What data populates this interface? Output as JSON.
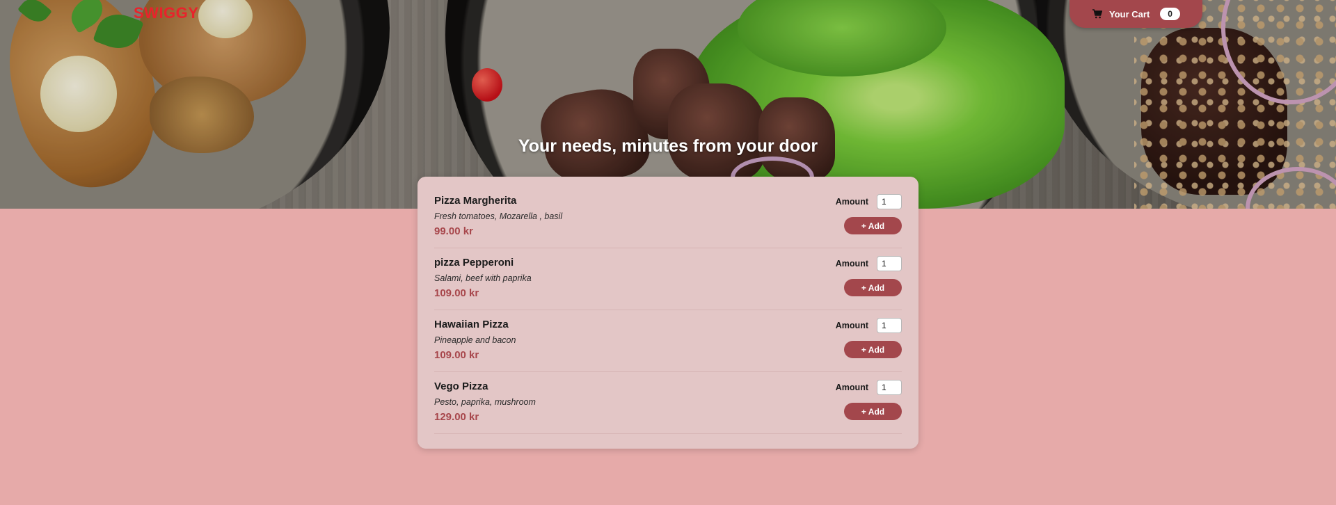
{
  "header": {
    "brand": "SWIGGY",
    "cart": {
      "label": "Your Cart",
      "count": "0",
      "icon": "cart-icon"
    },
    "headline": "Your needs, minutes from your door"
  },
  "menu": {
    "amount_label": "Amount",
    "add_label": "+ Add",
    "items": [
      {
        "name": "Pizza Margherita",
        "description": "Fresh tomatoes, Mozarella , basil",
        "price": "99.00 kr",
        "amount": "1"
      },
      {
        "name": "pizza Pepperoni",
        "description": "Salami, beef with paprika",
        "price": "109.00 kr",
        "amount": "1"
      },
      {
        "name": "Hawaiian Pizza",
        "description": "Pineapple and bacon",
        "price": "109.00 kr",
        "amount": "1"
      },
      {
        "name": "Vego Pizza",
        "description": "Pesto, paprika, mushroom",
        "price": "129.00 kr",
        "amount": "1"
      }
    ]
  },
  "colors": {
    "page_bg": "#e6aaa9",
    "card_bg": "#e3c6c6",
    "accent": "#a3474c",
    "brand": "#e8232b"
  }
}
